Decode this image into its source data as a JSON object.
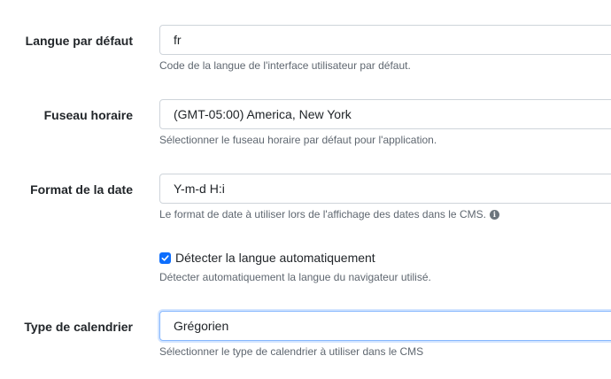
{
  "fields": {
    "language": {
      "label": "Langue par défaut",
      "value": "fr",
      "help": "Code de la langue de l'interface utilisateur par défaut."
    },
    "timezone": {
      "label": "Fuseau horaire",
      "value": "(GMT-05:00) America, New York",
      "help": "Sélectionner le fuseau horaire par défaut pour l'application."
    },
    "date_format": {
      "label": "Format de la date",
      "value": "Y-m-d H:i",
      "help": "Le format de date à utiliser lors de l'affichage des dates dans le CMS.",
      "icon": "info-circle-icon"
    },
    "detect_language": {
      "label": "Détecter la langue automatiquement",
      "checked": true,
      "help": "Détecter automatiquement la langue du navigateur utilisé."
    },
    "calendar_type": {
      "label": "Type de calendrier",
      "value": "Grégorien",
      "help": "Sélectionner le type de calendrier à utiliser dans le CMS"
    }
  },
  "colors": {
    "accent": "#0d6efd",
    "border": "#ced4da",
    "focus_border": "#86b7fe",
    "help_text": "#5f6770"
  }
}
